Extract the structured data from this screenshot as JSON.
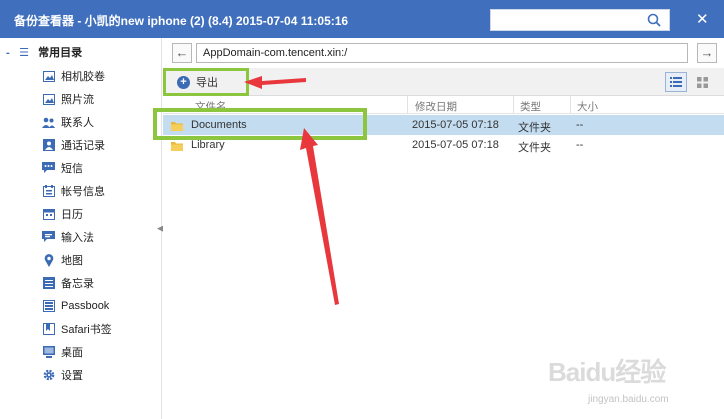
{
  "window": {
    "title": "备份查看器 - 小凯的new iphone (2) (8.4) 2015-07-04 11:05:16",
    "close_glyph": "✕"
  },
  "sidebar": {
    "group_label": "常用目录",
    "items": [
      {
        "label": "相机胶卷",
        "icon": "photo-icon"
      },
      {
        "label": "照片流",
        "icon": "photo-stream-icon"
      },
      {
        "label": "联系人",
        "icon": "contacts-icon"
      },
      {
        "label": "通话记录",
        "icon": "call-log-icon"
      },
      {
        "label": "短信",
        "icon": "message-icon"
      },
      {
        "label": "帐号信息",
        "icon": "account-icon"
      },
      {
        "label": "日历",
        "icon": "calendar-icon"
      },
      {
        "label": "输入法",
        "icon": "keyboard-icon"
      },
      {
        "label": "地图",
        "icon": "map-pin-icon"
      },
      {
        "label": "备忘录",
        "icon": "notes-icon"
      },
      {
        "label": "Passbook",
        "icon": "passbook-icon"
      },
      {
        "label": "Safari书签",
        "icon": "bookmark-icon"
      },
      {
        "label": "桌面",
        "icon": "desktop-icon"
      },
      {
        "label": "设置",
        "icon": "gear-icon"
      }
    ]
  },
  "pathbar": {
    "path": "AppDomain-com.tencent.xin:/",
    "back_glyph": "←",
    "forward_glyph": "→"
  },
  "toolbar": {
    "export_label": "导出"
  },
  "table": {
    "columns": [
      "文件名",
      "修改日期",
      "类型",
      "大小"
    ],
    "rows": [
      {
        "name": "Documents",
        "date": "2015-07-05 07:18",
        "type": "文件夹",
        "size": "--",
        "selected": true
      },
      {
        "name": "Library",
        "date": "2015-07-05 07:18",
        "type": "文件夹",
        "size": "--",
        "selected": false
      }
    ]
  },
  "watermark": {
    "logo": "Baidu经验",
    "url": "jingyan.baidu.com"
  },
  "colors": {
    "titlebar": "#3f6fbd",
    "accent": "#3b6bb5",
    "highlight": "#8cc63f",
    "arrow": "#e8383d",
    "selected_row": "#c3dcf0"
  }
}
